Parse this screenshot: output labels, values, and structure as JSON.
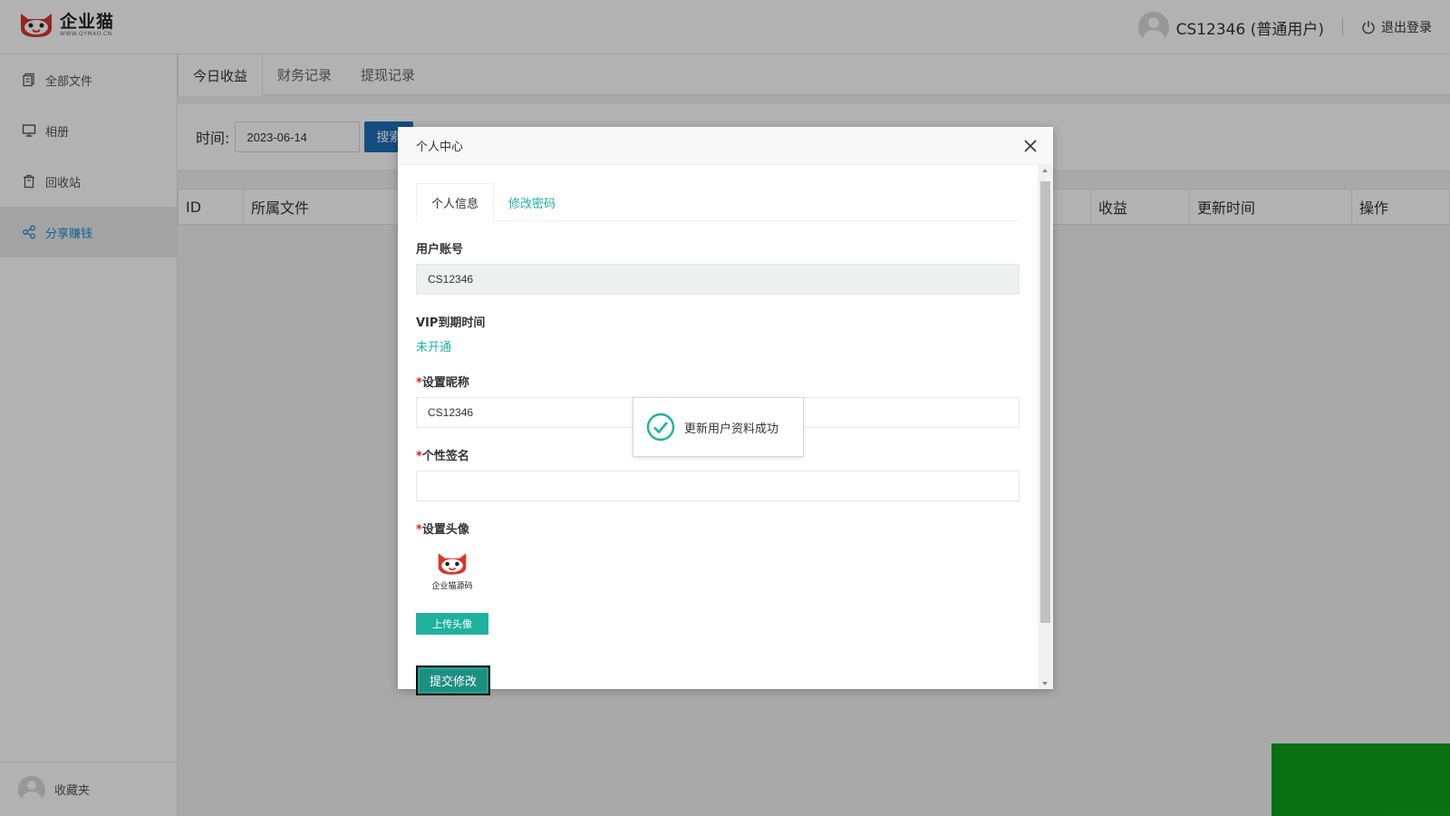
{
  "header": {
    "logo_name": "企业猫",
    "logo_url": "WWW.QYMAO.CN",
    "user_name": "CS12346 (普通用户)",
    "logout_label": "退出登录"
  },
  "sidebar": {
    "items": [
      {
        "label": "全部文件",
        "icon": "files-icon"
      },
      {
        "label": "相册",
        "icon": "monitor-icon"
      },
      {
        "label": "回收站",
        "icon": "trash-icon"
      },
      {
        "label": "分享赚钱",
        "icon": "share-icon"
      }
    ],
    "active_index": 3,
    "footer_label": "收藏夹"
  },
  "main": {
    "tabs": [
      "今日收益",
      "财务记录",
      "提现记录"
    ],
    "search": {
      "label": "时间:",
      "date_value": "2023-06-14",
      "button_label": "搜索"
    },
    "table_headers": [
      "ID",
      "所属文件",
      "收益",
      "更新时间",
      "操作"
    ]
  },
  "modal": {
    "title": "个人中心",
    "tabs": [
      "个人信息",
      "修改密码"
    ],
    "account_label": "用户账号",
    "account_value": "CS12346",
    "vip_label": "VIP到期时间",
    "vip_value": "未开通",
    "required_mark": "*",
    "nickname_label": "设置昵称",
    "nickname_value": "CS12346",
    "signature_label": "个性签名",
    "signature_value": "",
    "avatar_label": "设置头像",
    "avatar_caption": "企业猫源码",
    "upload_label": "上传头像",
    "submit_label": "提交修改"
  },
  "toast": {
    "message": "更新用户资料成功"
  },
  "colors": {
    "accent": "#1fb19e",
    "nav_active": "#1a8ad6",
    "search_button": "#1e6fb8",
    "logo_red": "#d9362b",
    "corner_green": "#0ea01a"
  }
}
